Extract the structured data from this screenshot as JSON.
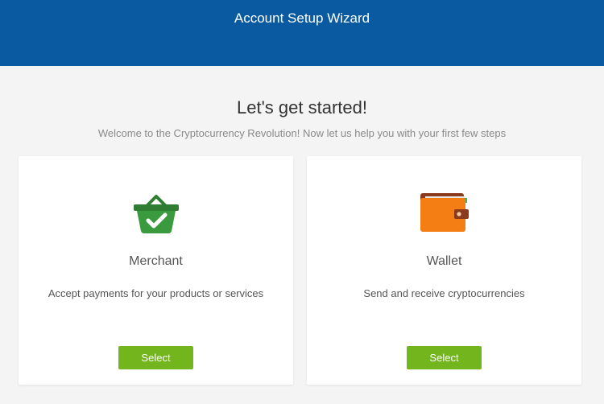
{
  "header": {
    "title": "Account Setup Wizard",
    "background_color": "#0a5aa2"
  },
  "intro": {
    "headline": "Let's get started!",
    "subtitle": "Welcome to the Cryptocurrency Revolution! Now let us help you with your first few steps"
  },
  "cards": [
    {
      "icon": "shopping-basket-check-icon",
      "title": "Merchant",
      "description": "Accept payments for your products or services",
      "button_label": "Select"
    },
    {
      "icon": "wallet-icon",
      "title": "Wallet",
      "description": "Send and receive cryptocurrencies",
      "button_label": "Select"
    }
  ],
  "colors": {
    "accent_button": "#72b51c",
    "basket_green": "#3a9a3e",
    "wallet_orange": "#f47d14",
    "wallet_brown": "#8b3a1e"
  }
}
